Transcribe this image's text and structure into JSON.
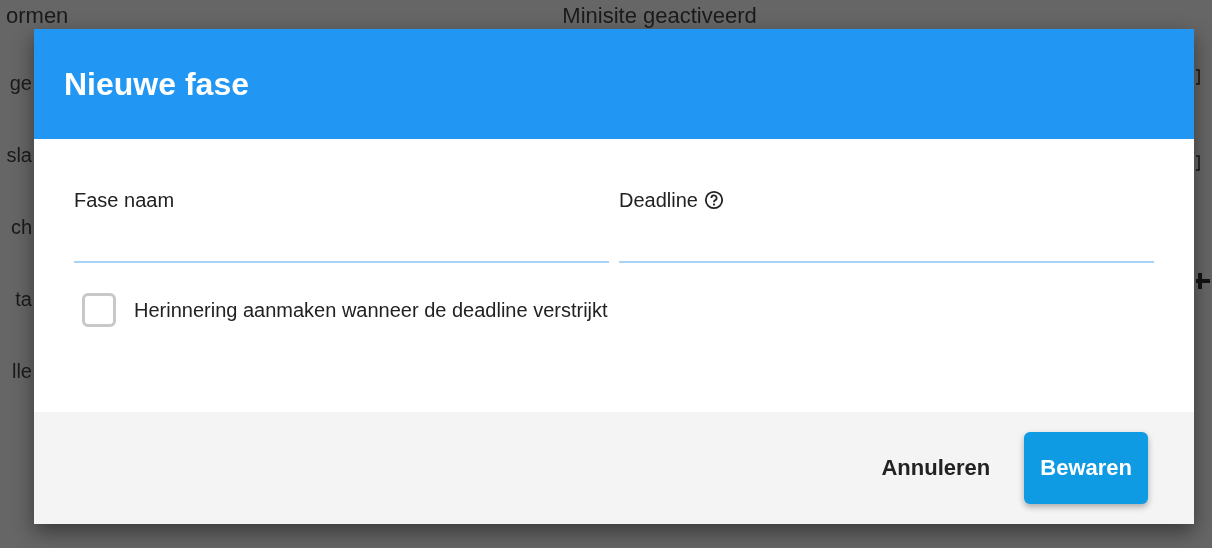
{
  "background": {
    "top_texts": [
      "ormen",
      "Minisite geactiveerd"
    ],
    "side_fragments": [
      "ge",
      "sla",
      "ch",
      "ta",
      "lle"
    ]
  },
  "dialog": {
    "title": "Nieuwe fase",
    "fields": [
      {
        "label": "Fase naam",
        "help": false
      },
      {
        "label": "Deadline",
        "help": true
      }
    ],
    "reminder": {
      "label": "Herinnering aanmaken wanneer de deadline verstrijkt",
      "checked": false
    },
    "buttons": [
      {
        "label": "Annuleren",
        "kind": "flat"
      },
      {
        "label": "Bewaren",
        "kind": "primary"
      }
    ]
  }
}
